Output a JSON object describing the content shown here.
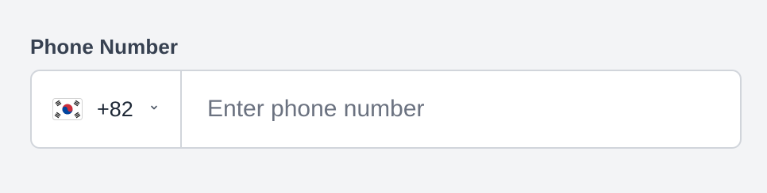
{
  "phone_field": {
    "label": "Phone Number",
    "country": {
      "flag_icon": "south-korea-flag-icon",
      "dial_code": "+82",
      "chevron_icon": "chevron-down-icon"
    },
    "input": {
      "value": "",
      "placeholder": "Enter phone number"
    }
  },
  "colors": {
    "background": "#f3f4f6",
    "border": "#d1d5db",
    "label_text": "#374151",
    "placeholder_text": "#6b7280"
  }
}
